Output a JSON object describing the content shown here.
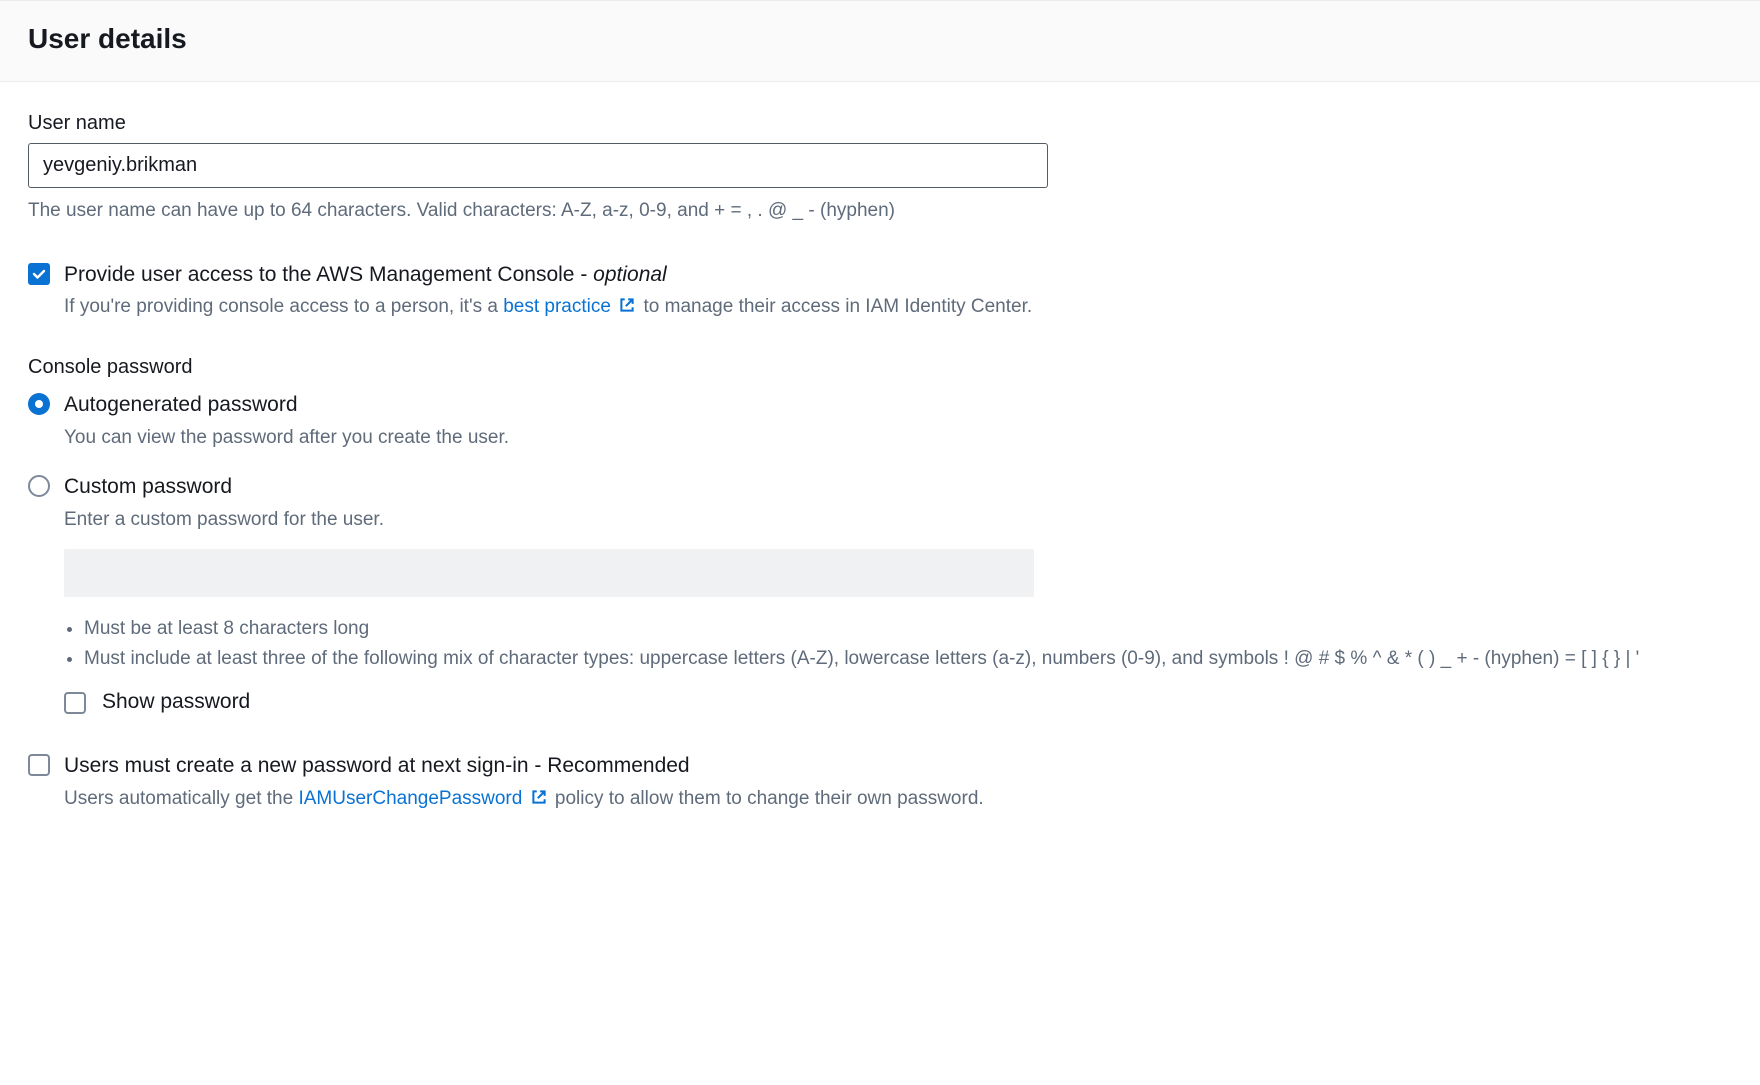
{
  "header": {
    "title": "User details"
  },
  "username": {
    "label": "User name",
    "value": "yevgeniy.brikman",
    "hint": "The user name can have up to 64 characters. Valid characters: A-Z, a-z, 0-9, and + = , . @ _ - (hyphen)"
  },
  "console_access": {
    "checked": true,
    "label_prefix": "Provide user access to the AWS Management Console - ",
    "label_suffix": "optional",
    "desc_prefix": "If you're providing console access to a person, it's a ",
    "desc_link": "best practice",
    "desc_suffix": " to manage their access in IAM Identity Center."
  },
  "console_password_label": "Console password",
  "password_options": {
    "auto": {
      "selected": true,
      "label": "Autogenerated password",
      "desc": "You can view the password after you create the user."
    },
    "custom": {
      "selected": false,
      "label": "Custom password",
      "desc": "Enter a custom password for the user.",
      "rules": [
        "Must be at least 8 characters long",
        "Must include at least three of the following mix of character types: uppercase letters (A-Z), lowercase letters (a-z), numbers (0-9), and symbols ! @ # $ % ^ & * ( ) _ + - (hyphen) = [ ] { } | '"
      ]
    }
  },
  "show_password": {
    "checked": false,
    "label": "Show password"
  },
  "must_reset": {
    "checked": false,
    "label": "Users must create a new password at next sign-in - Recommended",
    "desc_prefix": "Users automatically get the ",
    "desc_link": "IAMUserChangePassword",
    "desc_suffix": " policy to allow them to change their own password."
  }
}
